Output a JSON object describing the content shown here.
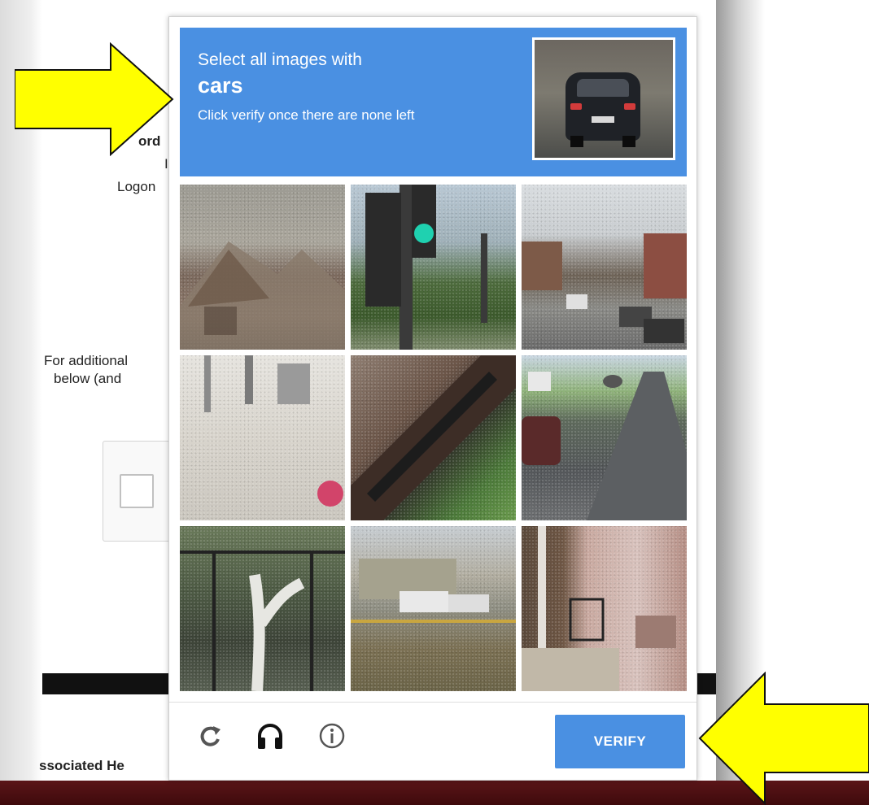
{
  "background_page": {
    "fragment_1": "ord",
    "fragment_2": "I",
    "fragment_3": "Logon",
    "fragment_4": "For additional",
    "fragment_5": "below (and",
    "footer_fragment": "ssociated He"
  },
  "captcha": {
    "instruction_line1": "Select all images with",
    "target_object": "cars",
    "instruction_line3": "Click verify once there are none left",
    "verify_label": "VERIFY",
    "tiles": [
      "house-image",
      "traffic-light-image",
      "street-with-cars-image",
      "building-wall-image",
      "bus-shelter-roof-image",
      "road-with-cars-image",
      "tree-and-fence-image",
      "parked-trucks-image",
      "building-entrance-image"
    ],
    "footer_icons": [
      "reload-icon",
      "headphones-icon",
      "info-icon"
    ],
    "colors": {
      "accent": "#4a90e2",
      "annotation_arrow": "#ffff00"
    }
  }
}
